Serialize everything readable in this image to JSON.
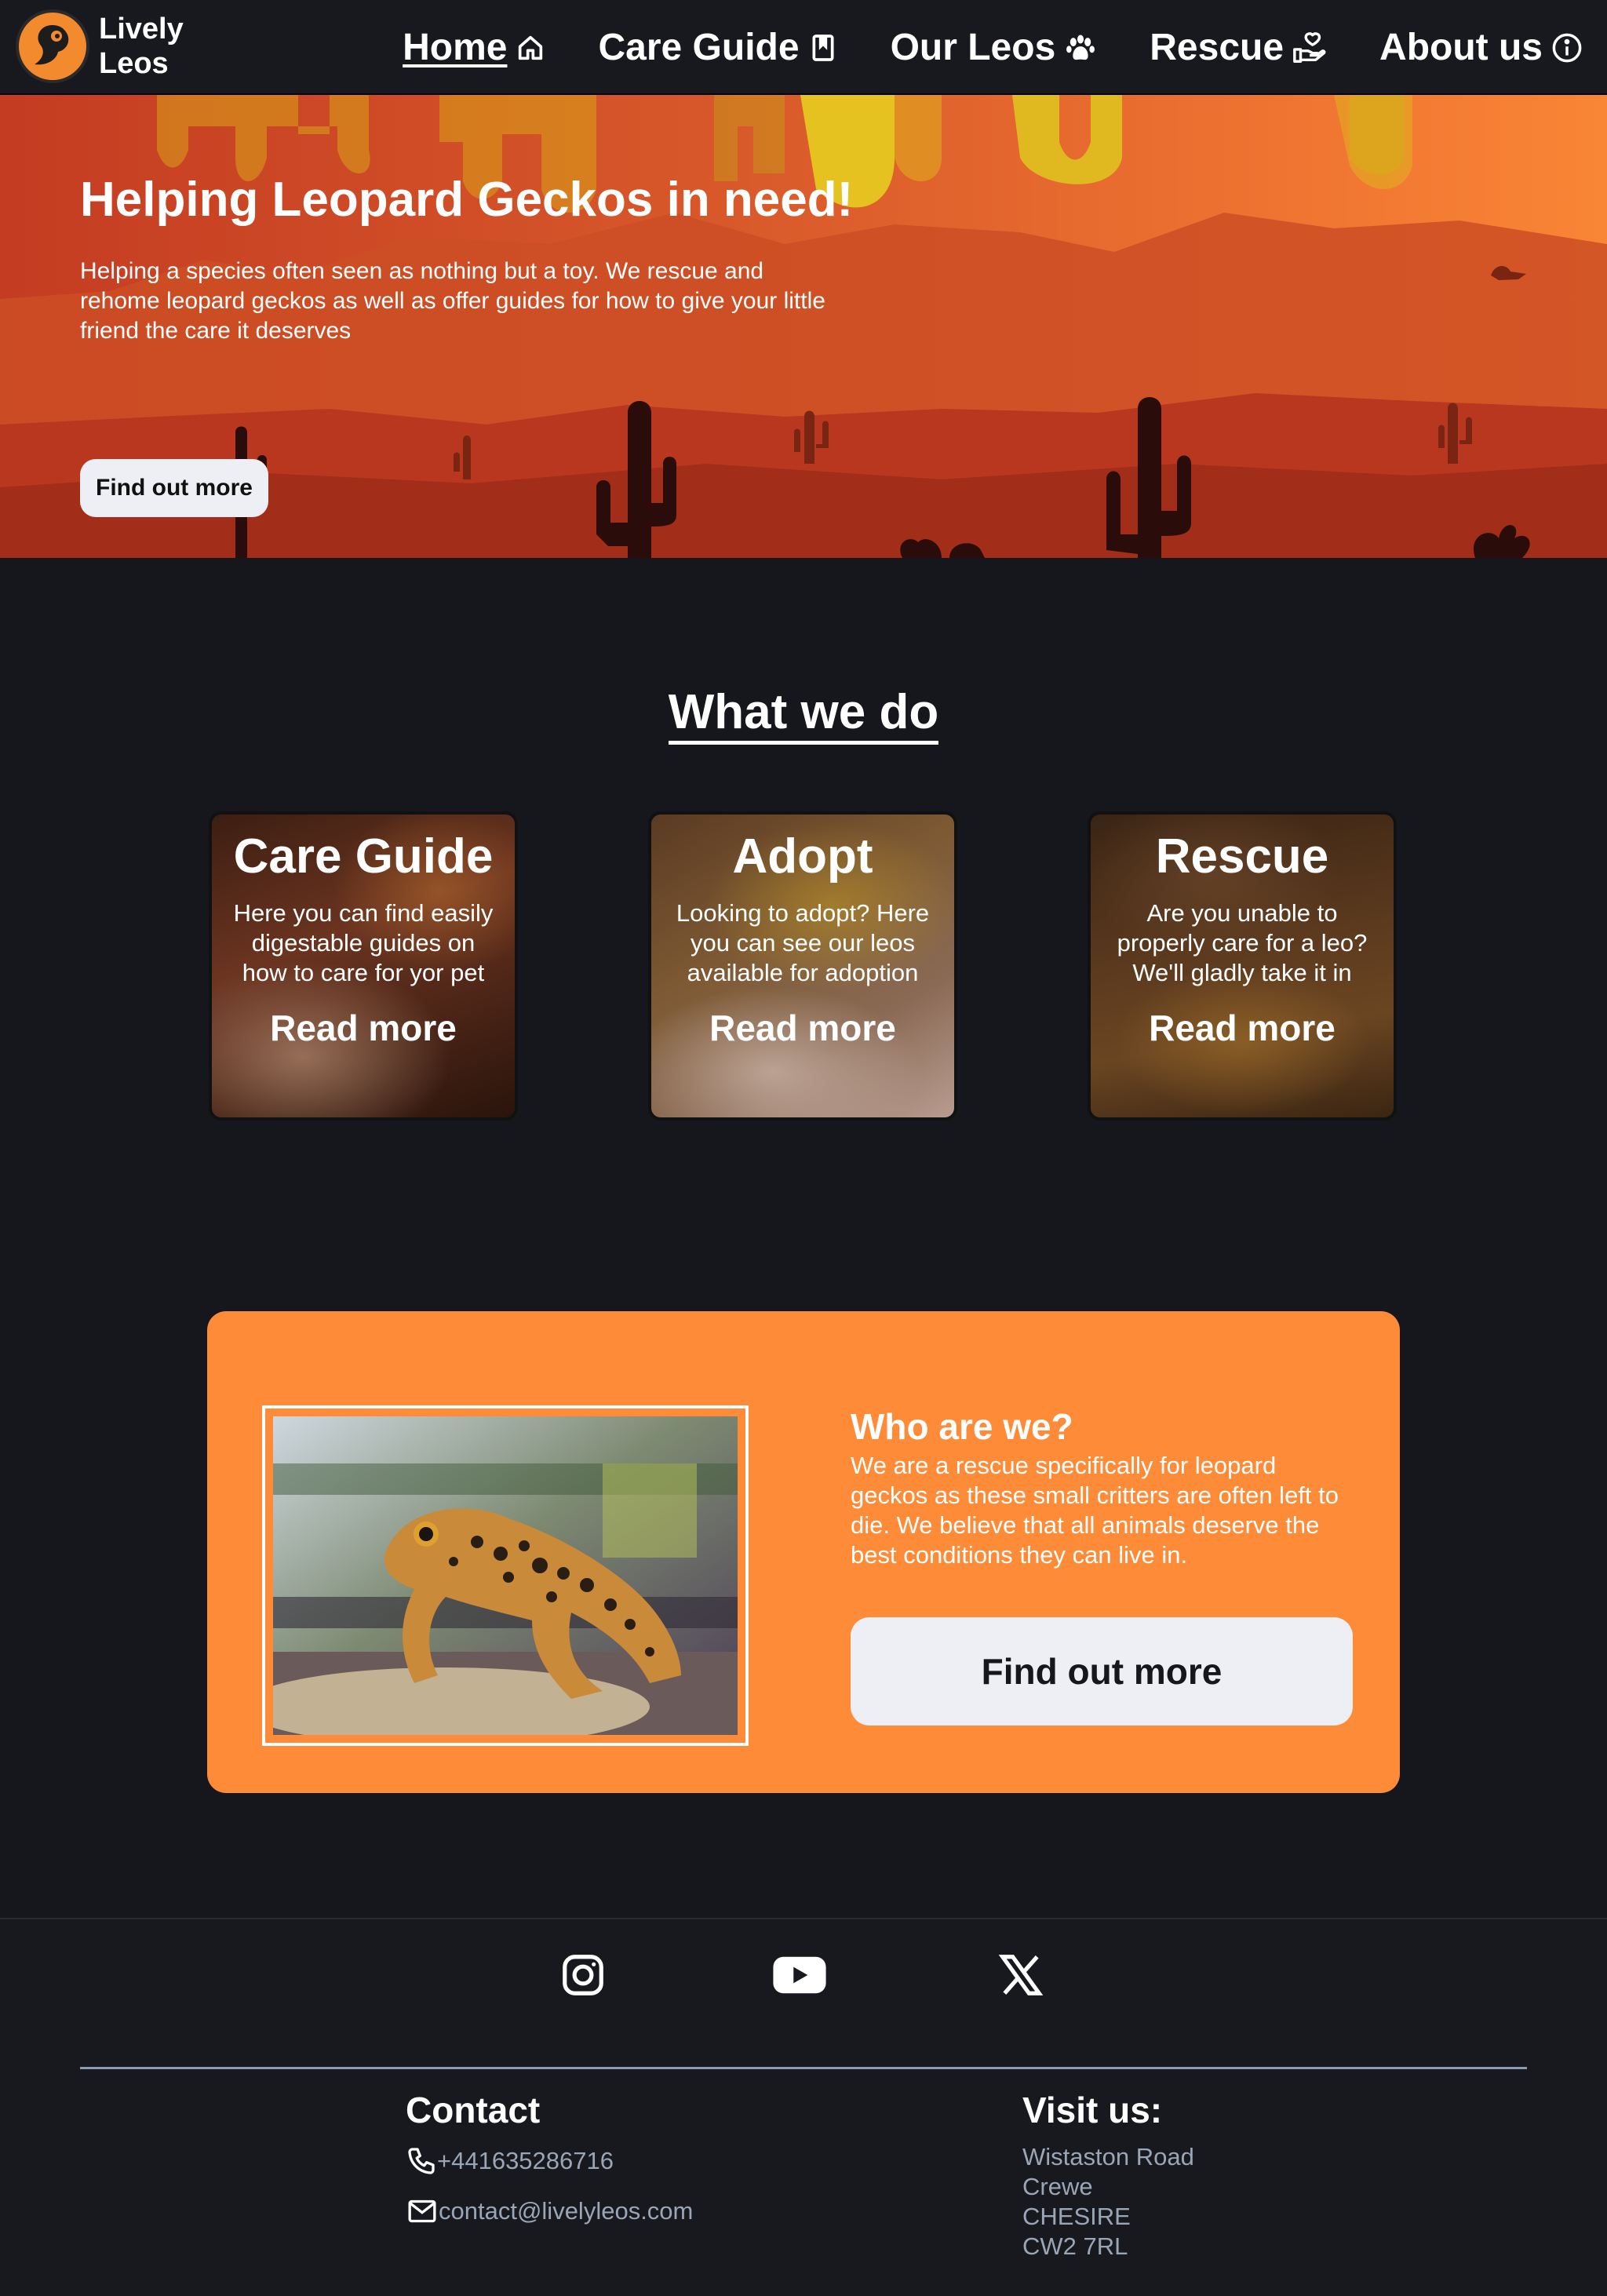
{
  "brand": {
    "name_line1": "Lively",
    "name_line2": "Leos",
    "logo_icon": "gecko-logo-icon"
  },
  "nav": {
    "items": [
      {
        "label": "Home",
        "icon": "home-icon",
        "active": true
      },
      {
        "label": "Care Guide",
        "icon": "book-icon",
        "active": false
      },
      {
        "label": "Our Leos",
        "icon": "paw-icon",
        "active": false
      },
      {
        "label": "Rescue",
        "icon": "hand-heart-icon",
        "active": false
      },
      {
        "label": "About us",
        "icon": "info-icon",
        "active": false
      }
    ]
  },
  "hero": {
    "title": "Helping Leopard Geckos in need!",
    "text": "Helping a species often seen as nothing but a toy. We rescue and rehome leopard geckos as well as offer guides for how to give your little friend the care it deserves",
    "button": "Find out more"
  },
  "what_we_do": {
    "title": "What we do",
    "cards": [
      {
        "title": "Care Guide",
        "text": "Here you can find easily digestable guides on how to care for yor pet",
        "link": "Read more"
      },
      {
        "title": "Adopt",
        "text": "Looking to adopt? Here you can see our leos available for adoption",
        "link": "Read more"
      },
      {
        "title": "Rescue",
        "text": "Are you unable to properly care for a leo? We'll gladly take it in",
        "link": "Read more"
      }
    ]
  },
  "who": {
    "title": "Who are we?",
    "text": "We are a rescue specifically for leopard geckos as these small critters are often left to die. We believe that all animals deserve the best conditions they can live in.",
    "button": "Find out more"
  },
  "footer": {
    "social": [
      "instagram-icon",
      "youtube-icon",
      "x-icon"
    ],
    "contact": {
      "title": "Contact",
      "phone": "+441635286716",
      "email": "contact@livelyleos.com"
    },
    "visit": {
      "title": "Visit us:",
      "line1": "Wistaston Road",
      "line2": "Crewe",
      "line3": "CHESIRE",
      "line4": "CW2 7RL"
    }
  },
  "colors": {
    "background": "#16171c",
    "accent_orange": "#fd8b37",
    "button_light": "#eeeff4",
    "footer_link": "#9aa5b6"
  }
}
